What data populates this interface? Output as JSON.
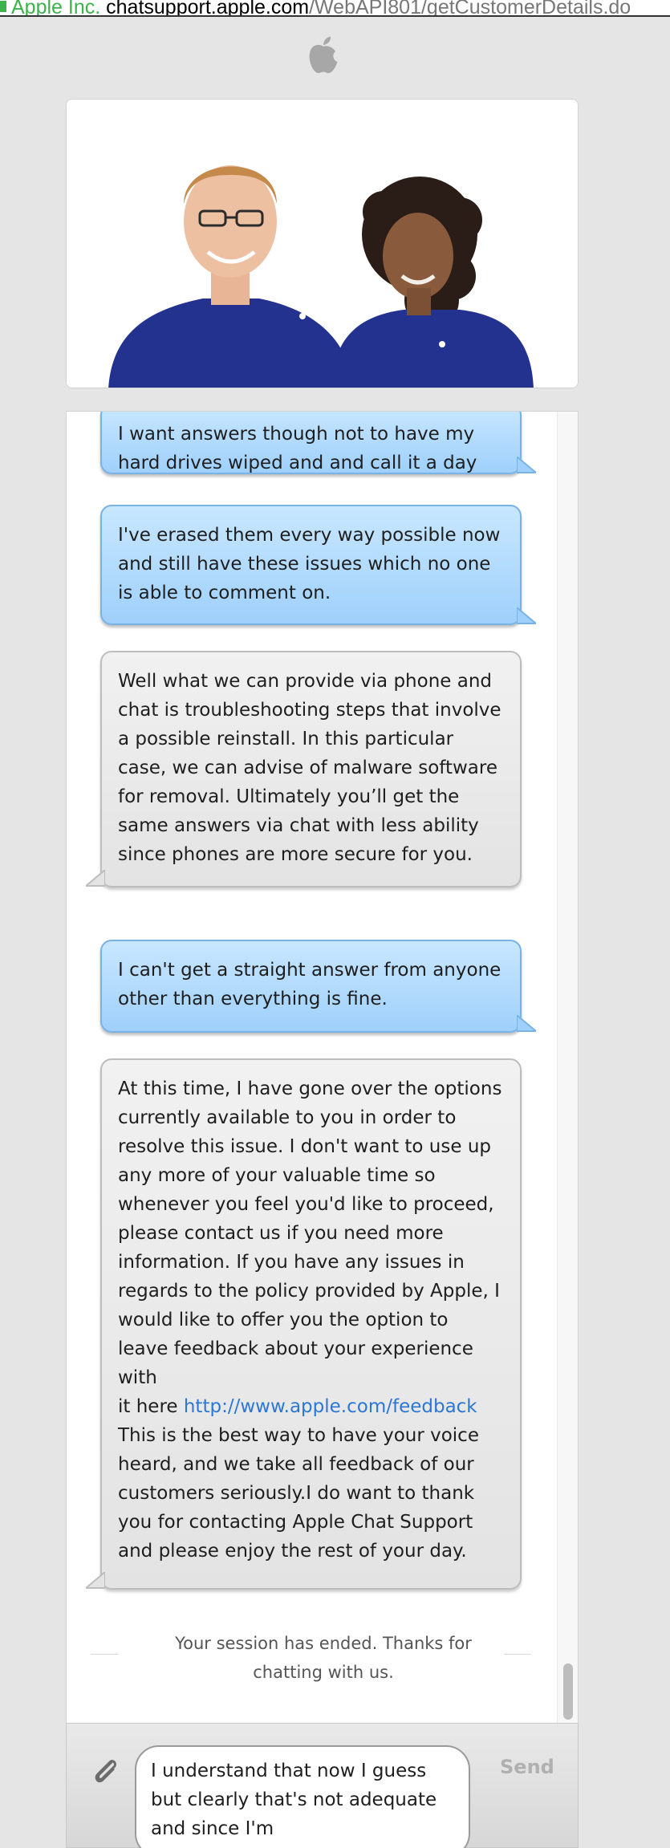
{
  "url_bar": {
    "organization": "Apple Inc.",
    "host": "chatsupport.apple.com",
    "path": "/WebAPI801/getCustomerDetails.do"
  },
  "colors": {
    "user_bubble": "#a8d6fc",
    "agent_bubble": "#ebebeb",
    "link": "#2b77d6",
    "shirt": "#23328f"
  },
  "transcript": [
    {
      "from": "user",
      "text": "I want answers though not to have my hard drives wiped and and call it a day"
    },
    {
      "from": "user",
      "text": "I've erased them every way possible now and still have these issues which no one is able to comment on."
    },
    {
      "from": "agent",
      "text": "Well what we can provide via phone and chat is troubleshooting steps that involve a possible reinstall. In this particular case, we can advise of malware software for removal. Ultimately you’ll get the same answers via chat with less ability since phones are more secure for you."
    },
    {
      "from": "user",
      "text": "I can't get a straight answer from anyone other than everything is fine."
    },
    {
      "from": "agent",
      "text_before": "At this time, I have gone over the options currently available to you in order to resolve this issue. I don't want to use up any more of your valuable time so whenever you feel you'd like to proceed, please contact us if you need more information. If you have any issues in regards to the policy provided by Apple, I would like to offer you the option to leave feedback about your experience with",
      "text_link_prefix": "it here ",
      "link": "http://www.apple.com/feedback",
      "text_after": "This is the best way to have your voice heard, and we take all feedback of our customers seriously.I do want to thank you for contacting Apple Chat Support and please enjoy the rest of your day."
    }
  ],
  "session_status": "Your session has ended. Thanks for chatting with us.",
  "composer": {
    "input_value": "I understand that now I guess but clearly that's not adequate and since I'm",
    "send_label": "Send"
  },
  "icons": {
    "apple_logo": "apple-logo-icon",
    "attachment": "paperclip-icon"
  }
}
